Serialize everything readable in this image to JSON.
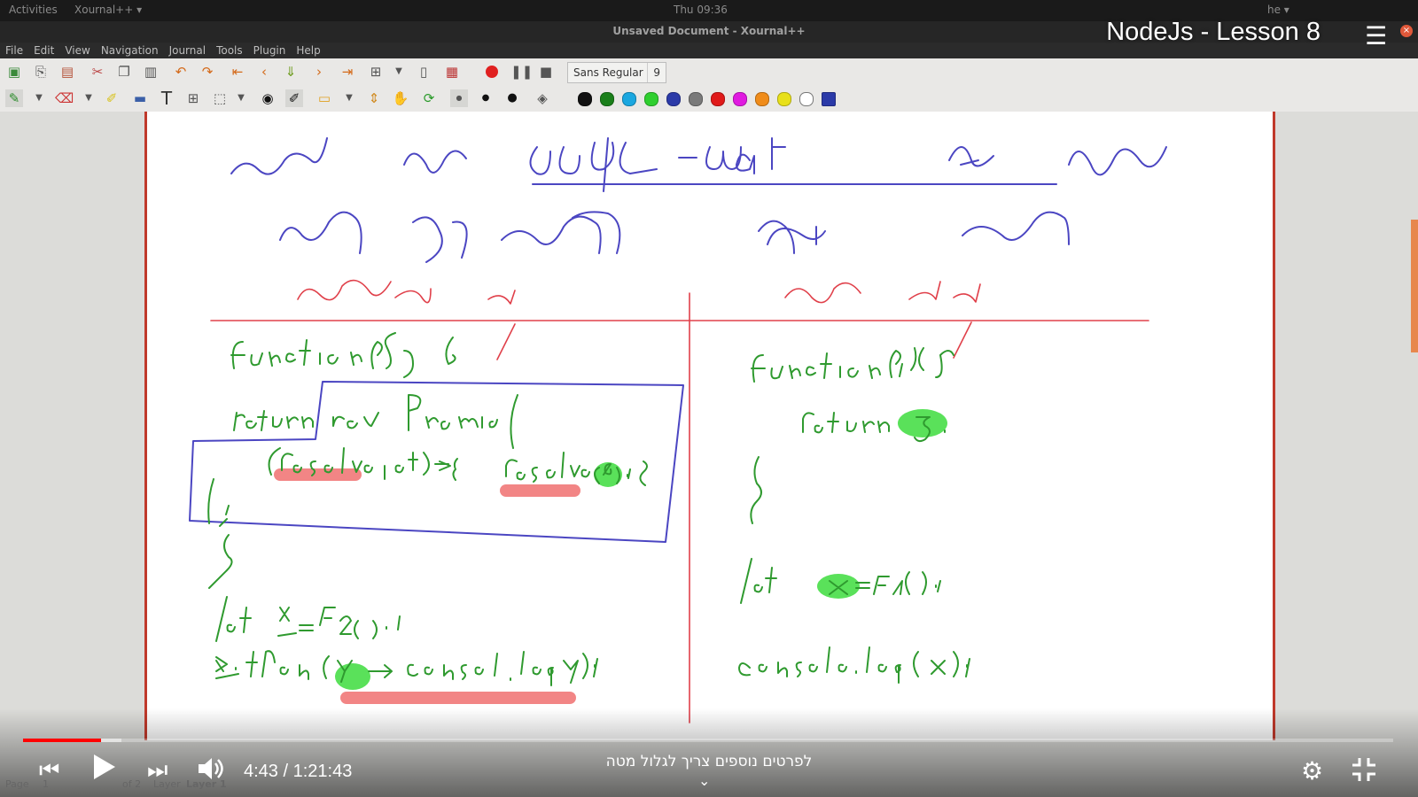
{
  "system_bar": {
    "activities": "Activities",
    "app": "Xournal++ ▾",
    "clock": "Thu 09:36",
    "lang": "he ▾"
  },
  "window": {
    "title": "Unsaved Document - Xournal++"
  },
  "menu": [
    "File",
    "Edit",
    "View",
    "Navigation",
    "Journal",
    "Tools",
    "Plugin",
    "Help"
  ],
  "font_selector": {
    "name": "Sans Regular",
    "size": "9"
  },
  "palette": [
    "#111111",
    "#1a7f1a",
    "#1aa7e0",
    "#2fcf2f",
    "#2b3aa8",
    "#7a7a7a",
    "#e01a1a",
    "#e01ae0",
    "#f08c1a",
    "#e8e01a",
    "#ffffff",
    "#2b3aa8"
  ],
  "video": {
    "title": "NodeJs - Lesson 8",
    "time": "4:43 / 1:21:43",
    "played_fraction": 0.057,
    "buffered_fraction": 0.072,
    "hint": "לפרטים נוספים צריך לגלול מטה"
  },
  "statusbar": {
    "page_label": "Page",
    "page": "1",
    "of": "of 2",
    "layer_label": "Layer",
    "layer": "Layer 1"
  },
  "notes": {
    "heading": "המרה של async - await הינה לדוגמאות",
    "left_col": "תכנות סינכרוני",
    "right_col": "מתכנות אסינכרוני",
    "sync_code": [
      "function f1(){",
      "return 5;",
      "}",
      "let x=f1();",
      "console.log(x);"
    ],
    "async_code": [
      "function f2(){",
      "return new Promise(",
      "(resolve, reject)=>{resolve(5);}",
      "});",
      "}",
      "let x=f2();",
      "x.then(y=>console.log(y));"
    ]
  }
}
